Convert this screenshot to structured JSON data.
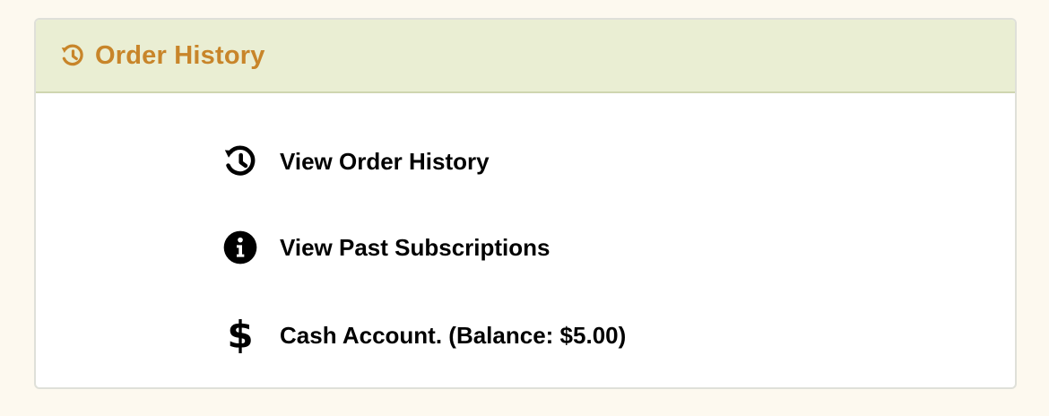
{
  "header": {
    "title": "Order History",
    "icon": "history-icon",
    "color": "#c8852a",
    "background": "#eaeed3"
  },
  "menu": {
    "items": [
      {
        "label": "View Order History",
        "icon": "history-icon"
      },
      {
        "label": "View Past Subscriptions",
        "icon": "info-circle-icon"
      },
      {
        "label": "Cash Account. (Balance: $5.00)",
        "icon": "dollar-icon"
      }
    ]
  }
}
